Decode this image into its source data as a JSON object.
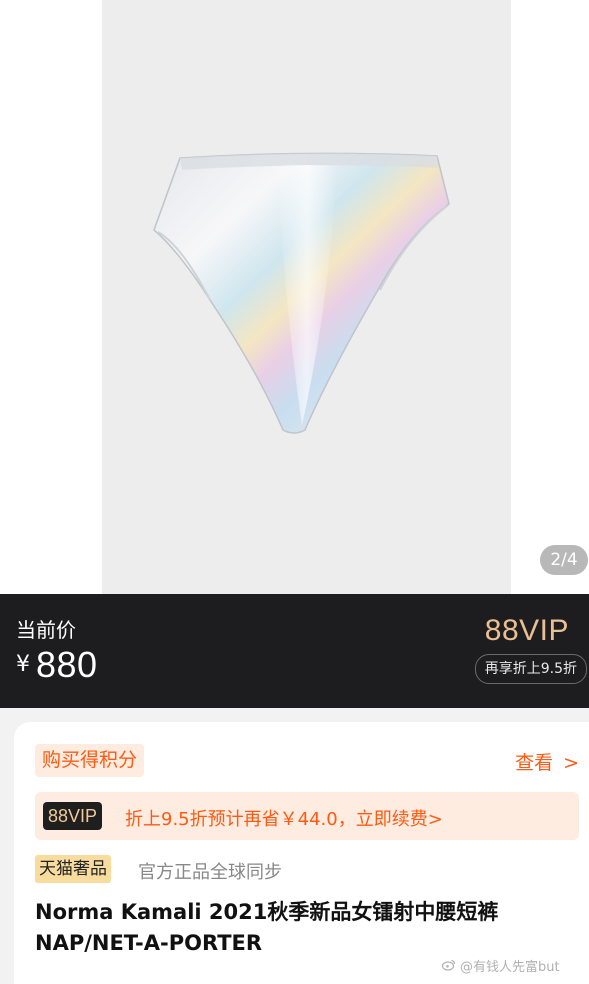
{
  "gallery": {
    "indicator": "2/4"
  },
  "price": {
    "label": "当前价",
    "currency": "¥",
    "value": "880",
    "vip_tag": "88VIP",
    "vip_sub": "再享折上9.5折"
  },
  "card": {
    "points_tag": "购买得积分",
    "view_link": "查看",
    "view_chevron": ">",
    "vip_badge": "88VIP",
    "vip_strip_text": "折上9.5折预计再省￥44.0，立即续费>",
    "brand_badge": "天猫奢品",
    "brand_note": "官方正品全球同步",
    "title": "Norma Kamali 2021秋季新品女镭射中腰短裤NAP/NET-A-PORTER"
  },
  "watermark": {
    "text": "@有钱人先富but",
    "icon": "weibo-icon"
  },
  "colors": {
    "accent": "#ff5a13",
    "vip_gold": "#e9bf93",
    "dark_band": "#1d1d1f"
  }
}
